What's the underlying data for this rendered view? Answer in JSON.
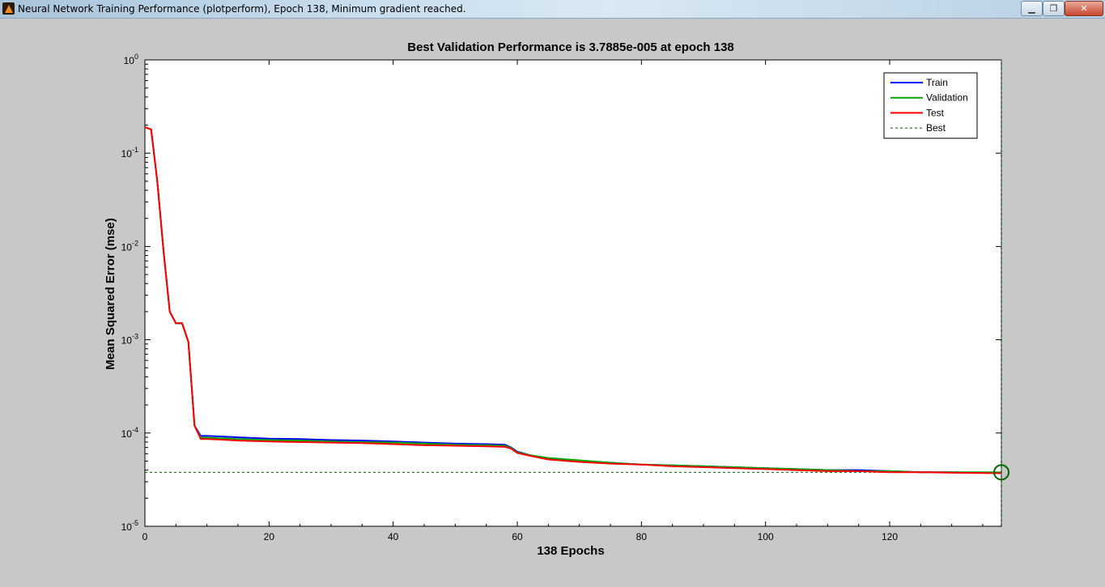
{
  "window": {
    "title": "Neural Network Training Performance (plotperform), Epoch 138, Minimum gradient reached.",
    "minimize_symbol": "▁",
    "maximize_symbol": "❐",
    "close_symbol": "✕"
  },
  "chart_data": {
    "type": "line",
    "title": "Best Validation Performance is 3.7885e-005 at epoch 138",
    "xlabel": "138 Epochs",
    "ylabel": "Mean Squared Error  (mse)",
    "xlim": [
      0,
      138
    ],
    "ylim": [
      1e-05,
      1
    ],
    "yscale": "log",
    "xticks": [
      0,
      20,
      40,
      60,
      80,
      100,
      120
    ],
    "yticks": [
      {
        "value": 1,
        "base": "10",
        "exp": "0"
      },
      {
        "value": 0.1,
        "base": "10",
        "exp": "-1"
      },
      {
        "value": 0.01,
        "base": "10",
        "exp": "-2"
      },
      {
        "value": 0.001,
        "base": "10",
        "exp": "-3"
      },
      {
        "value": 0.0001,
        "base": "10",
        "exp": "-4"
      },
      {
        "value": 1e-05,
        "base": "10",
        "exp": "-5"
      }
    ],
    "grid": false,
    "legend_position": "top-right",
    "best": {
      "epoch": 138,
      "value": 3.7885e-05
    },
    "series": [
      {
        "name": "Train",
        "color": "#0000ff",
        "x": [
          0,
          1,
          2,
          3,
          4,
          5,
          6,
          7,
          8,
          9,
          10,
          12,
          15,
          20,
          25,
          30,
          35,
          40,
          45,
          50,
          55,
          58,
          59,
          60,
          62,
          65,
          70,
          75,
          80,
          85,
          90,
          95,
          100,
          105,
          110,
          115,
          120,
          125,
          130,
          135,
          138
        ],
        "y": [
          0.19,
          0.18,
          0.05,
          0.009,
          0.002,
          0.0015,
          0.0015,
          0.00095,
          0.00012,
          9.3e-05,
          9.3e-05,
          9.2e-05,
          9e-05,
          8.7e-05,
          8.6e-05,
          8.4e-05,
          8.3e-05,
          8.1e-05,
          7.9e-05,
          7.7e-05,
          7.6e-05,
          7.5e-05,
          7e-05,
          6.3e-05,
          5.8e-05,
          5.3e-05,
          5e-05,
          4.8e-05,
          4.6e-05,
          4.5e-05,
          4.4e-05,
          4.3e-05,
          4.2e-05,
          4.1e-05,
          4e-05,
          4e-05,
          3.9e-05,
          3.8e-05,
          3.8e-05,
          3.75e-05,
          3.73e-05
        ]
      },
      {
        "name": "Validation",
        "color": "#00aa00",
        "x": [
          0,
          1,
          2,
          3,
          4,
          5,
          6,
          7,
          8,
          9,
          10,
          12,
          15,
          20,
          25,
          30,
          35,
          40,
          45,
          50,
          55,
          58,
          59,
          60,
          62,
          65,
          70,
          75,
          80,
          85,
          90,
          95,
          100,
          105,
          110,
          115,
          120,
          125,
          130,
          135,
          138
        ],
        "y": [
          0.19,
          0.18,
          0.05,
          0.009,
          0.002,
          0.0015,
          0.0015,
          0.00095,
          0.00012,
          8.9e-05,
          8.9e-05,
          8.8e-05,
          8.6e-05,
          8.4e-05,
          8.3e-05,
          8.1e-05,
          8e-05,
          7.9e-05,
          7.7e-05,
          7.5e-05,
          7.4e-05,
          7.3e-05,
          6.9e-05,
          6.2e-05,
          5.8e-05,
          5.4e-05,
          5.1e-05,
          4.8e-05,
          4.6e-05,
          4.5e-05,
          4.4e-05,
          4.3e-05,
          4.2e-05,
          4.1e-05,
          4e-05,
          3.9e-05,
          3.9e-05,
          3.8e-05,
          3.8e-05,
          3.8e-05,
          3.7885e-05
        ]
      },
      {
        "name": "Test",
        "color": "#ff0000",
        "x": [
          0,
          1,
          2,
          3,
          4,
          5,
          6,
          7,
          8,
          9,
          10,
          12,
          15,
          20,
          25,
          30,
          35,
          40,
          45,
          50,
          55,
          58,
          59,
          60,
          62,
          65,
          70,
          75,
          80,
          85,
          90,
          95,
          100,
          105,
          110,
          115,
          120,
          125,
          130,
          135,
          138
        ],
        "y": [
          0.19,
          0.18,
          0.05,
          0.009,
          0.002,
          0.0015,
          0.0015,
          0.00095,
          0.00012,
          8.6e-05,
          8.6e-05,
          8.5e-05,
          8.3e-05,
          8.1e-05,
          8e-05,
          7.9e-05,
          7.8e-05,
          7.6e-05,
          7.4e-05,
          7.3e-05,
          7.2e-05,
          7.1e-05,
          6.8e-05,
          6.1e-05,
          5.7e-05,
          5.2e-05,
          4.9e-05,
          4.7e-05,
          4.6e-05,
          4.4e-05,
          4.3e-05,
          4.2e-05,
          4.1e-05,
          4e-05,
          3.9e-05,
          3.9e-05,
          3.8e-05,
          3.8e-05,
          3.75e-05,
          3.72e-05,
          3.7e-05
        ]
      },
      {
        "name": "Best",
        "color": "#006600",
        "style": "dotted"
      }
    ]
  }
}
